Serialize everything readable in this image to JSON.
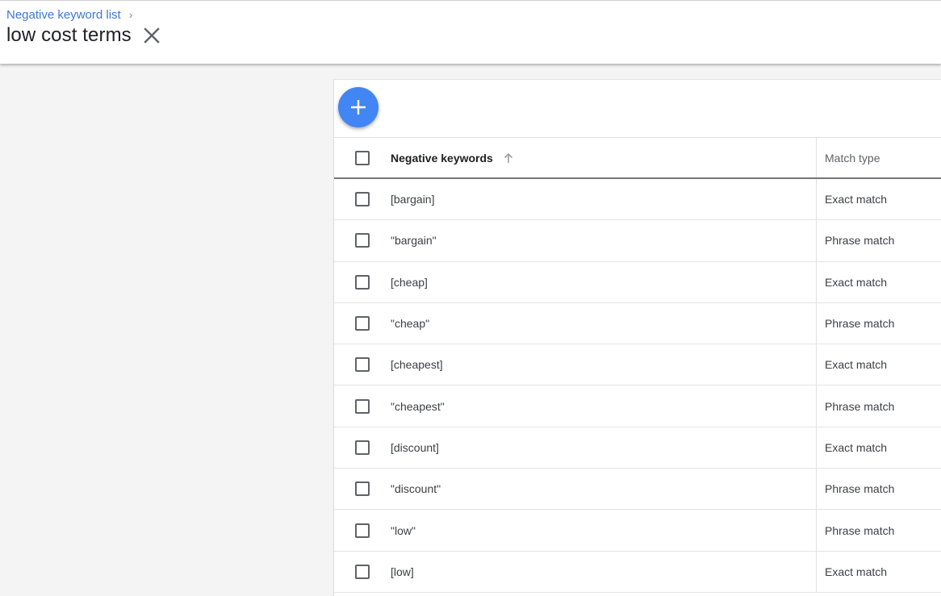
{
  "header": {
    "breadcrumb": "Negative keyword list",
    "title": "low cost terms"
  },
  "table": {
    "columns": {
      "keywords": "Negative keywords",
      "match_type": "Match type"
    },
    "rows": [
      {
        "keyword": "[bargain]",
        "match": "Exact match"
      },
      {
        "keyword": "\"bargain\"",
        "match": "Phrase match"
      },
      {
        "keyword": "[cheap]",
        "match": "Exact match"
      },
      {
        "keyword": "\"cheap\"",
        "match": "Phrase match"
      },
      {
        "keyword": "[cheapest]",
        "match": "Exact match"
      },
      {
        "keyword": "\"cheapest\"",
        "match": "Phrase match"
      },
      {
        "keyword": "[discount]",
        "match": "Exact match"
      },
      {
        "keyword": "\"discount\"",
        "match": "Phrase match"
      },
      {
        "keyword": "\"low\"",
        "match": "Phrase match"
      },
      {
        "keyword": "[low]",
        "match": "Exact match"
      }
    ]
  },
  "icons": {
    "breadcrumb_separator": "chevron-right-icon",
    "close": "close-icon",
    "add": "plus-icon",
    "sort": "arrow-up-icon"
  },
  "colors": {
    "accent": "#4285f4",
    "link": "#3c78d8"
  }
}
